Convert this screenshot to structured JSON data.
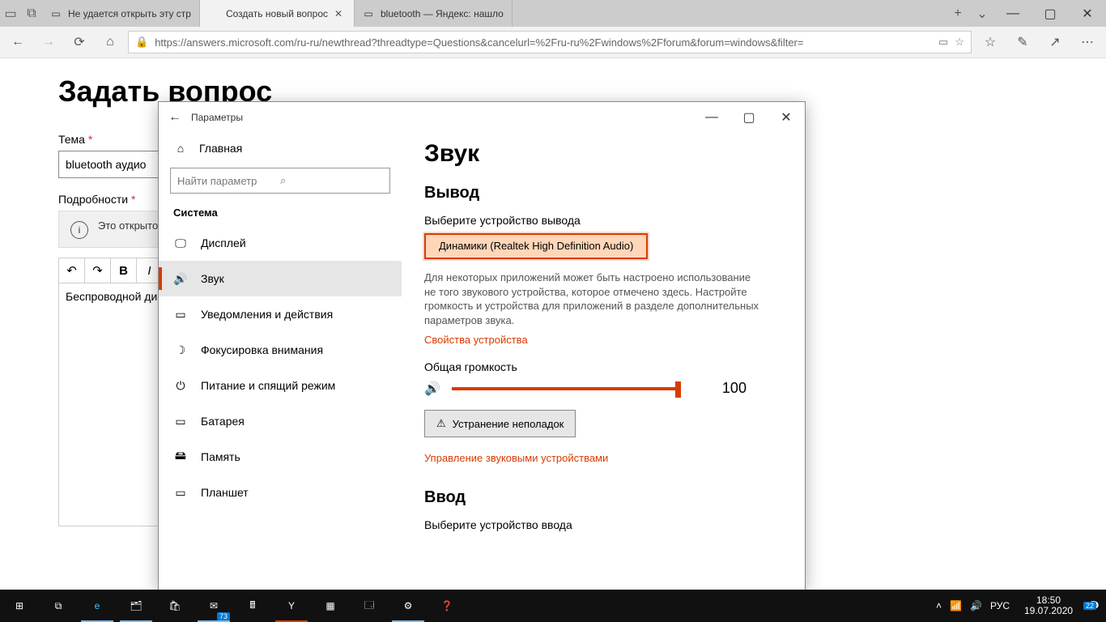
{
  "browser": {
    "tabs": [
      {
        "label": "Не удается открыть эту стр"
      },
      {
        "label": "Создать новый вопрос"
      },
      {
        "label": "bluetooth — Яндекс: нашло"
      }
    ],
    "url": "https://answers.microsoft.com/ru-ru/newthread?threadtype=Questions&cancelurl=%2Fru-ru%2Fwindows%2Fforum&forum=windows&filter="
  },
  "page": {
    "title": "Задать вопрос",
    "theme_label": "Тема",
    "theme_value": "bluetooth аудио",
    "details_label": "Подробности",
    "infobar": "Это открытой телефона, кл",
    "editor_text": "Беспроводной ди"
  },
  "settings": {
    "win_title": "Параметры",
    "home": "Главная",
    "search_placeholder": "Найти параметр",
    "category": "Система",
    "nav": [
      {
        "icon": "display",
        "label": "Дисплей"
      },
      {
        "icon": "sound",
        "label": "Звук"
      },
      {
        "icon": "notif",
        "label": "Уведомления и действия"
      },
      {
        "icon": "focus",
        "label": "Фокусировка внимания"
      },
      {
        "icon": "power",
        "label": "Питание и спящий режим"
      },
      {
        "icon": "battery",
        "label": "Батарея"
      },
      {
        "icon": "storage",
        "label": "Память"
      },
      {
        "icon": "tablet",
        "label": "Планшет"
      }
    ],
    "main": {
      "h1": "Звук",
      "output_h": "Вывод",
      "output_label": "Выберите устройство вывода",
      "output_device": "Динамики (Realtek High Definition Audio)",
      "output_desc": "Для некоторых приложений может быть настроено использование не того звукового устройства, которое отмечено здесь. Настройте громкость и устройства для приложений в разделе дополнительных параметров звука.",
      "device_props": "Свойства устройства",
      "volume_label": "Общая громкость",
      "volume_value": "100",
      "troubleshoot": "Устранение неполадок",
      "manage_devices": "Управление звуковыми устройствами",
      "input_h": "Ввод",
      "input_label": "Выберите устройство ввода"
    }
  },
  "taskbar": {
    "mail_badge": "73",
    "lang": "РУС",
    "time": "18:50",
    "date": "19.07.2020",
    "notif_badge": "22"
  }
}
